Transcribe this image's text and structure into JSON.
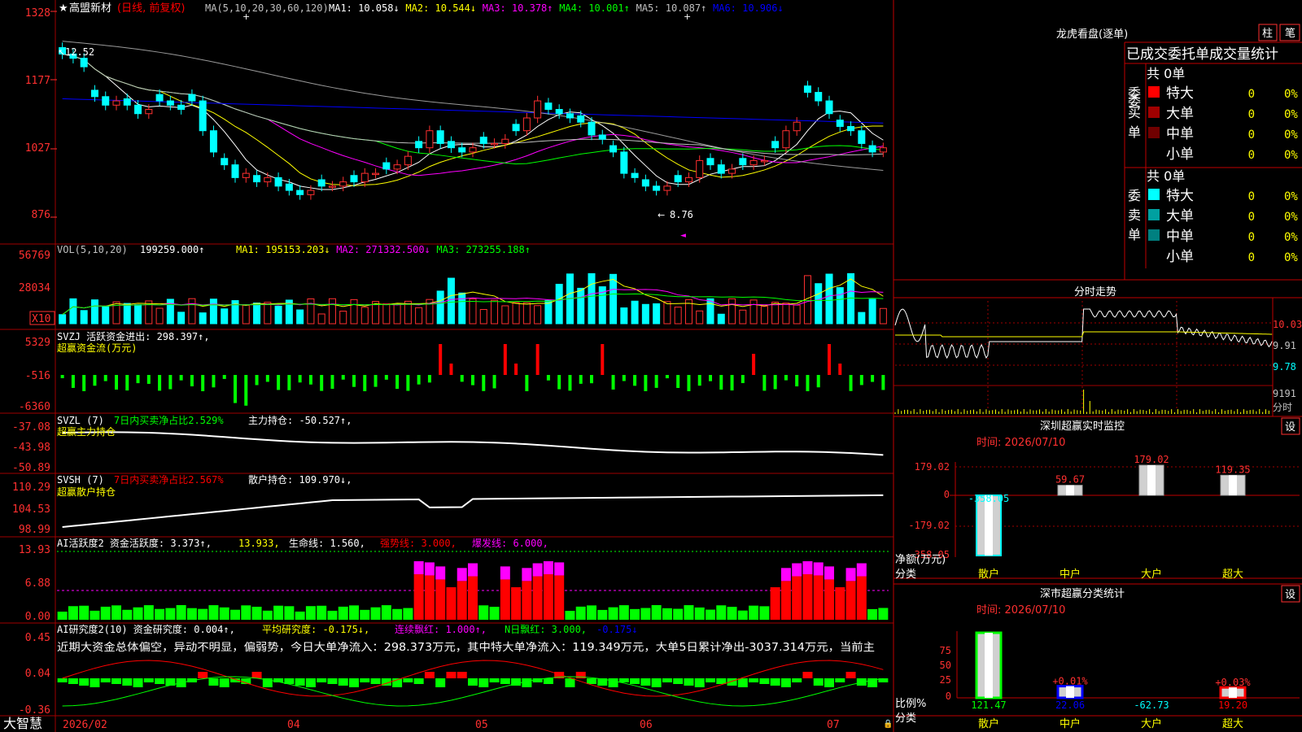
{
  "stock": {
    "star": "★",
    "name": "高盟新材",
    "period": "(日线, 前复权)"
  },
  "ma_header": {
    "label": "MA(5,10,20,30,60,120)",
    "items": [
      {
        "text": "MA1: 10.058↓",
        "color": "#ffffff"
      },
      {
        "text": "MA2: 10.544↓",
        "color": "#ffff00"
      },
      {
        "text": "MA3: 10.378↑",
        "color": "#ff00ff"
      },
      {
        "text": "MA4: 10.001↑",
        "color": "#00ff00"
      },
      {
        "text": "MA5: 10.087↑",
        "color": "#c0c0c0"
      },
      {
        "text": "MA6: 10.906↓",
        "color": "#0000ff"
      }
    ]
  },
  "price_axis": [
    "1328",
    "1177",
    "1027",
    "876"
  ],
  "price_marks": {
    "high": "12.52",
    "low": "8.76"
  },
  "vol_header": {
    "label": "VOL(5,10,20)",
    "value": "199259.000↑",
    "items": [
      {
        "text": "MA1: 195153.203↓",
        "color": "#ffff00"
      },
      {
        "text": "MA2: 271332.500↓",
        "color": "#ff00ff"
      },
      {
        "text": "MA3: 273255.188↑",
        "color": "#00ff00"
      }
    ]
  },
  "vol_axis": [
    "56769",
    "28034",
    "X10"
  ],
  "svzj": {
    "line1": "SVZJ  活跃资金进出: 298.397↑,",
    "line2": "超赢资金流(万元)",
    "axis": [
      "5329",
      "-516",
      "-6360"
    ]
  },
  "svzl": {
    "name": "SVZL (7)",
    "ratio": "7日内买卖净占比2.529%",
    "hold": "主力持仓: -50.527↑,",
    "line2": "超赢主力持仓",
    "axis": [
      "-37.08",
      "-43.98",
      "-50.89"
    ]
  },
  "svsh": {
    "name": "SVSH (7)",
    "ratio": "7日内买卖净占比2.567%",
    "hold": "散户持仓: 109.970↓,",
    "line2": "超赢散户持仓",
    "axis": [
      "110.29",
      "104.53",
      "98.99"
    ]
  },
  "ai_active": {
    "prefix": "AI活跃度2 资金活跃度: 3.373↑,",
    "v2": "13.933,",
    "life": "生命线: 1.560,",
    "strong": "强势线: 3.000,",
    "burst": "爆发线: 6.000,",
    "axis": [
      "13.93",
      "6.88",
      "0.00"
    ]
  },
  "ai_research": {
    "prefix": "AI研究度2(10) 资金研究度: 0.004↑,",
    "avg": "平均研究度: -0.175↓,",
    "red": "连续飘红: 1.000↑,",
    "nday": "N日飘红: 3.000,",
    "last": "-0.175↓",
    "axis": [
      "0.45",
      "0.04",
      "-0.36"
    ],
    "commentary": "近期大资金总体偏空，异动不明显，偏弱势，今日大单净流入：298.373万元，其中特大单净流入：119.349万元，大单5日累计净出-3037.314万元，当前主"
  },
  "date_axis": [
    "2026/02",
    "04",
    "05",
    "06",
    "07"
  ],
  "footer": {
    "logo": "大智慧"
  },
  "dragon": {
    "title": "龙虎看盘(逐单)",
    "btn1": "柱",
    "btn2": "笔",
    "subtitle": "已成交委托单成交量统计",
    "buy": {
      "label": "委买单",
      "total": "共 0单",
      "rows": [
        {
          "name": "特大",
          "color": "#ff0000",
          "v": "0",
          "p": "0%"
        },
        {
          "name": "大单",
          "color": "#a00000",
          "v": "0",
          "p": "0%"
        },
        {
          "name": "中单",
          "color": "#700000",
          "v": "0",
          "p": "0%"
        },
        {
          "name": "小单",
          "color": "#000000",
          "v": "0",
          "p": "0%"
        }
      ]
    },
    "sell": {
      "label": "委卖单",
      "total": "共 0单",
      "rows": [
        {
          "name": "特大",
          "color": "#00ffff",
          "v": "0",
          "p": "0%"
        },
        {
          "name": "大单",
          "color": "#00a0a0",
          "v": "0",
          "p": "0%"
        },
        {
          "name": "中单",
          "color": "#008080",
          "v": "0",
          "p": "0%"
        },
        {
          "name": "小单",
          "color": "#000000",
          "v": "0",
          "p": "0%"
        }
      ]
    }
  },
  "intraday": {
    "title": "分时走势",
    "axis": [
      "10.03",
      "9.91",
      "9.78",
      "9191",
      "分时"
    ]
  },
  "sz_monitor": {
    "title": "深圳超赢实时监控",
    "btn": "设",
    "time": "时间: 2026/07/10",
    "axis": [
      "179.02",
      "0",
      "-179.02",
      "-358.05"
    ],
    "ylabel": "净额(万元)",
    "xlabel": "分类",
    "bars": [
      {
        "cat": "散户",
        "value": -358.05,
        "label": "-358.05"
      },
      {
        "cat": "中户",
        "value": 59.67,
        "label": "59.67"
      },
      {
        "cat": "大户",
        "value": 179.02,
        "label": "179.02"
      },
      {
        "cat": "超大",
        "value": 119.35,
        "label": "119.35"
      }
    ]
  },
  "sz_class": {
    "title": "深市超赢分类统计",
    "btn": "设",
    "time": "时间: 2026/07/10",
    "axis": [
      "75",
      "50",
      "25",
      "0"
    ],
    "ylabel": "比例%",
    "xlabel": "分类",
    "bars": [
      {
        "cat": "散户",
        "value": 100,
        "label": "121.47",
        "pct": "",
        "color": "#00ff00"
      },
      {
        "cat": "中户",
        "value": 18,
        "label": "22.06",
        "pct": "+0.01%",
        "color": "#0000ff"
      },
      {
        "cat": "大户",
        "value": 0,
        "label": "-62.73",
        "pct": "",
        "color": "#00ffff"
      },
      {
        "cat": "超大",
        "value": 16,
        "label": "19.20",
        "pct": "+0.03%",
        "color": "#ff0000"
      }
    ]
  },
  "chart_data": {
    "type": "candlestick",
    "price_range": [
      8.76,
      13.28
    ],
    "high_mark": 12.52,
    "low_mark": 8.76,
    "moving_averages": {
      "MA1": 10.058,
      "MA2": 10.544,
      "MA3": 10.378,
      "MA4": 10.001,
      "MA5": 10.087,
      "MA6": 10.906
    },
    "volume": {
      "last": 199259.0,
      "MA1": 195153.203,
      "MA2": 271332.5,
      "MA3": 273255.188,
      "max": 56769
    },
    "closes": [
      12.4,
      12.3,
      12.1,
      11.4,
      11.2,
      11.3,
      11.2,
      11.0,
      11.1,
      11.3,
      11.2,
      11.1,
      11.3,
      10.6,
      10.1,
      9.8,
      9.5,
      9.6,
      9.4,
      9.5,
      9.3,
      9.2,
      9.1,
      9.2,
      9.3,
      9.3,
      9.4,
      9.4,
      9.6,
      9.6,
      9.7,
      9.8,
      10.0,
      10.2,
      10.6,
      10.3,
      10.2,
      10.1,
      10.2,
      10.3,
      10.3,
      10.4,
      10.6,
      10.9,
      11.3,
      11.1,
      11.0,
      10.9,
      10.8,
      10.5,
      10.4,
      10.1,
      9.6,
      9.5,
      9.3,
      9.2,
      9.3,
      9.4,
      9.5,
      9.9,
      9.8,
      9.6,
      9.7,
      9.8,
      9.9,
      9.9,
      10.2,
      10.6,
      10.8,
      11.5,
      11.3,
      11.0,
      10.7,
      10.6,
      10.3,
      10.1,
      10.2
    ]
  }
}
